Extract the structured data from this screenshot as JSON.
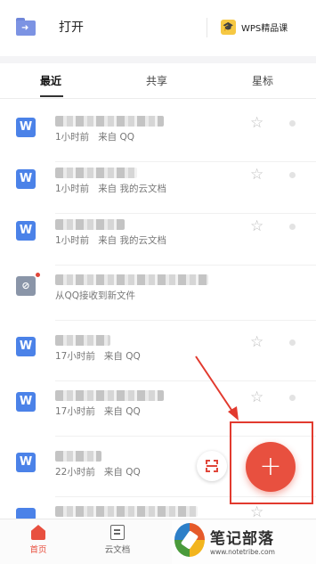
{
  "header": {
    "open_label": "打开",
    "wps_course_label": "WPS精品课"
  },
  "tabs": [
    {
      "label": "最近",
      "active": true
    },
    {
      "label": "共享",
      "active": false
    },
    {
      "label": "星标",
      "active": false
    }
  ],
  "files": [
    {
      "icon": "W",
      "time": "1小时前",
      "source": "来自 QQ"
    },
    {
      "icon": "W",
      "time": "1小时前",
      "source": "来自 我的云文档"
    },
    {
      "icon": "W",
      "time": "1小时前",
      "source": "来自 我的云文档"
    },
    {
      "icon": "share",
      "time": "",
      "source": "从QQ接收到新文件",
      "unread": true
    },
    {
      "icon": "W",
      "time": "17小时前",
      "source": "来自 QQ"
    },
    {
      "icon": "W",
      "time": "17小时前",
      "source": "来自 QQ"
    },
    {
      "icon": "W",
      "time": "22小时前",
      "source": "来自 QQ"
    }
  ],
  "fab": {
    "label": "+"
  },
  "bottom_nav": [
    {
      "label": "首页",
      "active": true
    },
    {
      "label": "云文档",
      "active": false
    }
  ],
  "watermark": {
    "title": "笔记部落",
    "url": "www.notetribe.com"
  },
  "colors": {
    "accent": "#e8503f",
    "file_icon": "#4b82e8",
    "annotation": "#e23a2e"
  }
}
